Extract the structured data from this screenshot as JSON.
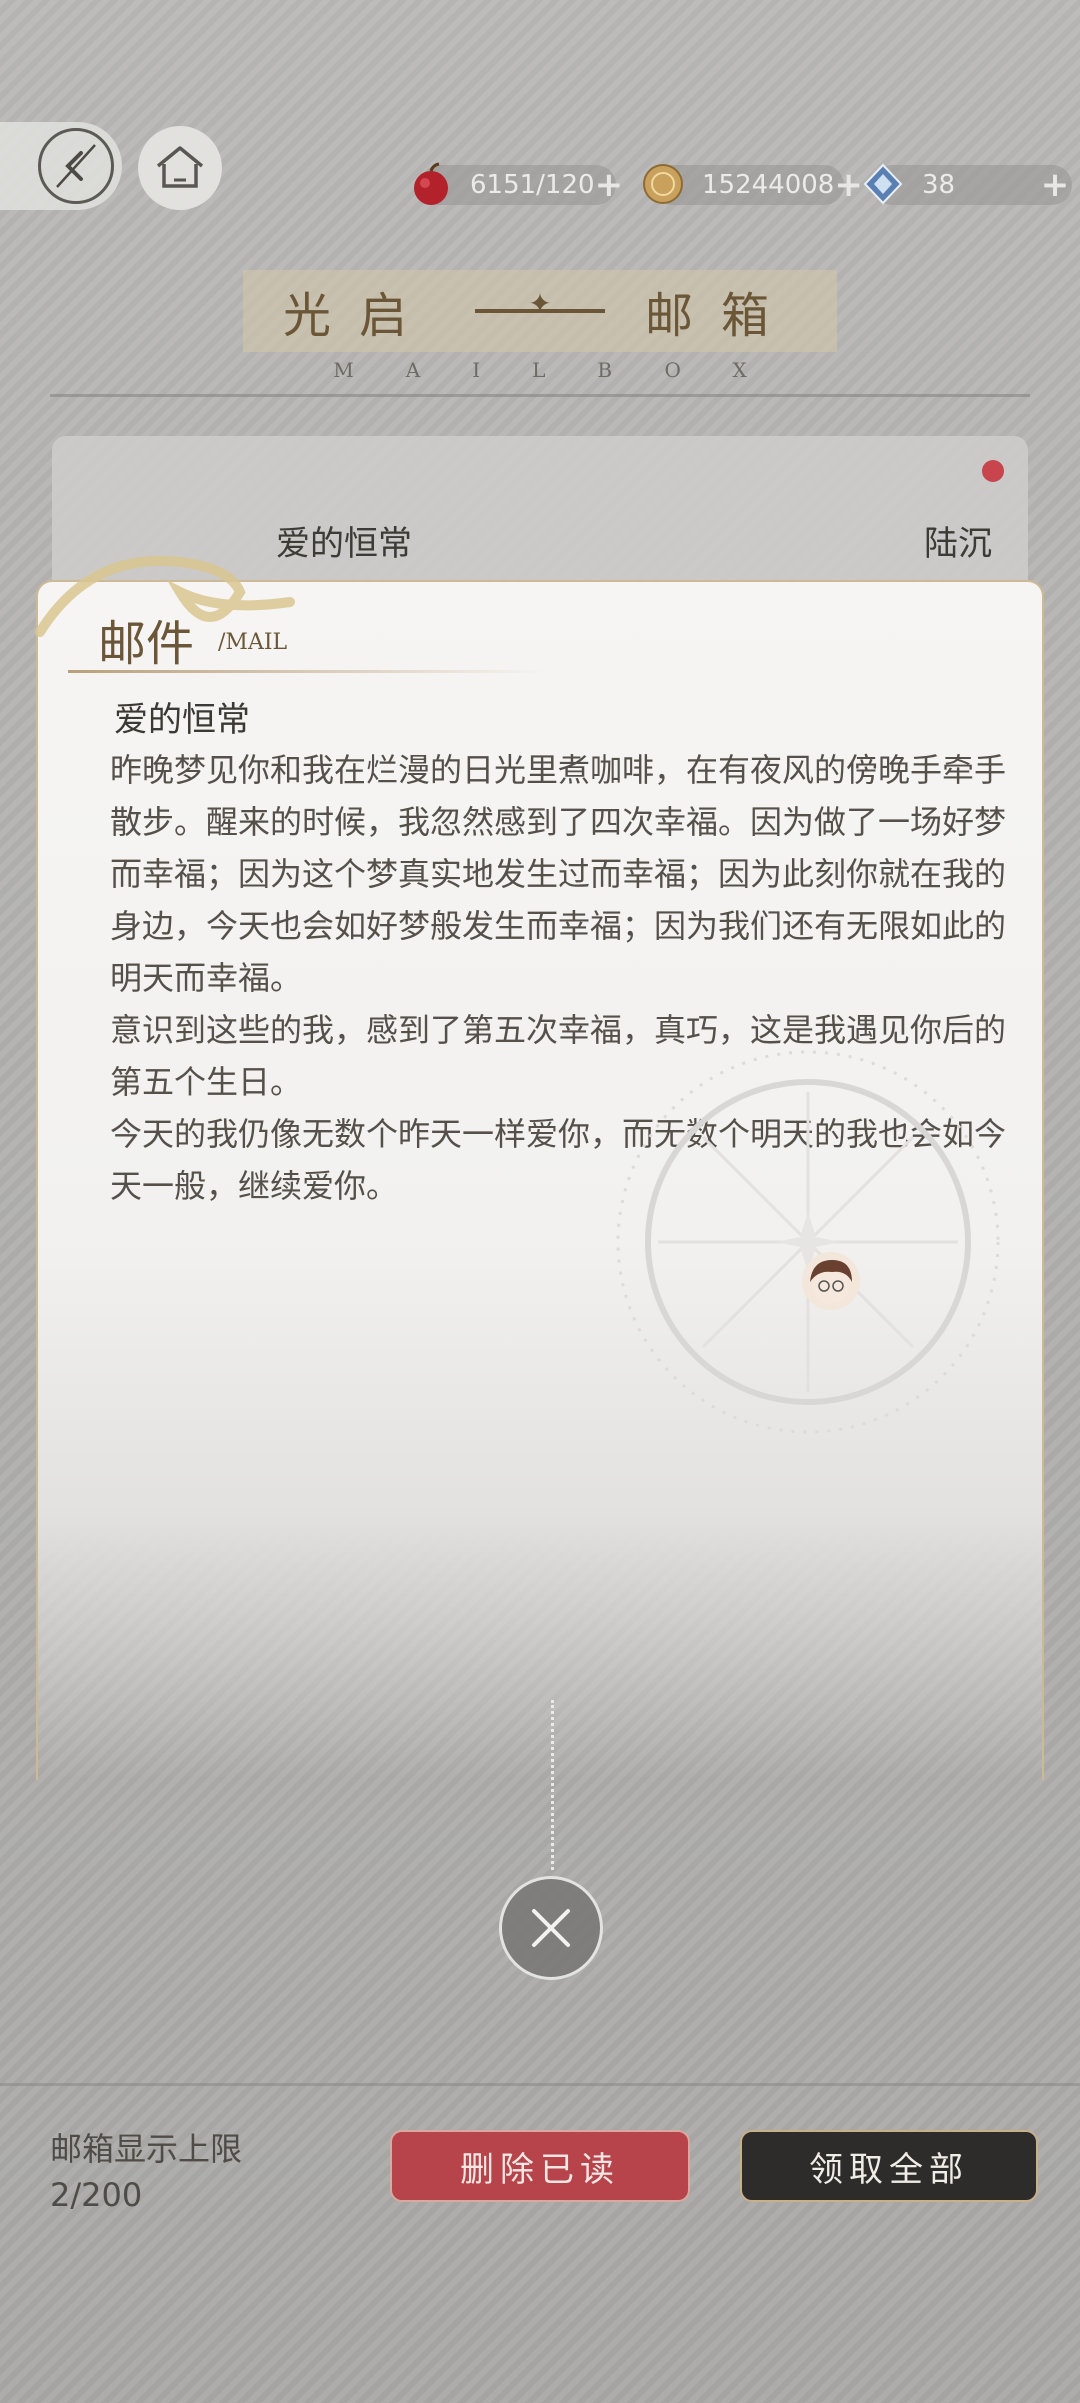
{
  "resources": {
    "stamina": "6151/120",
    "coins": "15244008",
    "crystals": "38"
  },
  "page": {
    "title_left": "光启",
    "title_right": "邮箱",
    "subtitle": "MAILBOX"
  },
  "mail_list": [
    {
      "subject": "爱的恒常",
      "sender": "陆沉",
      "unread": true
    }
  ],
  "mail_detail": {
    "header": "邮件",
    "header_en": "/MAIL",
    "title": "爱的恒常",
    "paragraphs": [
      "昨晚梦见你和我在烂漫的日光里煮咖啡，在有夜风的傍晚手牵手散步。醒来的时候，我忽然感到了四次幸福。因为做了一场好梦而幸福；因为这个梦真实地发生过而幸福；因为此刻你就在我的身边，今天也会如好梦般发生而幸福；因为我们还有无限如此的明天而幸福。",
      "意识到这些的我，感到了第五次幸福，真巧，这是我遇见你后的第五个生日。",
      "今天的我仍像无数个昨天一样爱你，而无数个明天的我也会如今天一般，继续爱你。"
    ]
  },
  "footer": {
    "limit_label": "邮箱显示上限",
    "limit_value": "2/200",
    "delete_read": "删除已读",
    "claim_all": "领取全部"
  },
  "colors": {
    "accent_gold": "#6b5738",
    "delete_red": "#b7434b",
    "unread_dot": "#c8454e",
    "dark_button": "#2e2c2a"
  }
}
